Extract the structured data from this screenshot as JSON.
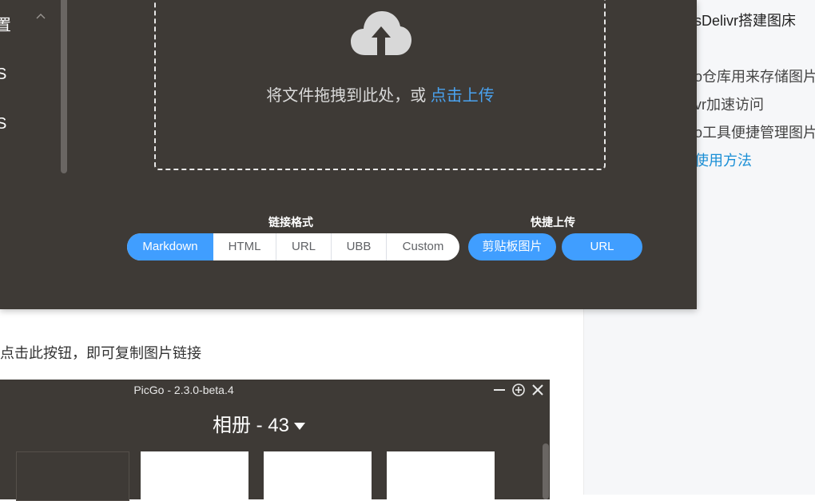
{
  "panel": {
    "side_items": [
      "置",
      "S",
      "S"
    ],
    "drop_text": "将文件拖拽到此处，或 ",
    "drop_link": "点击上传",
    "link_format_label": "链接格式",
    "quick_upload_label": "快捷上传",
    "formats": [
      {
        "label": "Markdown",
        "active": true
      },
      {
        "label": "HTML",
        "active": false
      },
      {
        "label": "URL",
        "active": false
      },
      {
        "label": "UBB",
        "active": false
      },
      {
        "label": "Custom",
        "active": false
      }
    ],
    "clipboard_button": "剪贴板图片",
    "url_button": "URL"
  },
  "toc": {
    "items": [
      {
        "text": "sDelivr搭建图床",
        "kind": "title"
      },
      {
        "text": "o仓库用来存储图片",
        "kind": "normal"
      },
      {
        "text": "vr加速访问",
        "kind": "normal"
      },
      {
        "text": "o工具便捷管理图片",
        "kind": "normal"
      },
      {
        "text": "使用方法",
        "kind": "link"
      }
    ]
  },
  "article": {
    "caption": "点击此按钮，即可复制图片链接"
  },
  "album": {
    "window_title": "PicGo - 2.3.0-beta.4",
    "heading": "相册 - 43"
  },
  "colors": {
    "panel_bg": "#3e3a36",
    "accent": "#409eff",
    "link": "#4aa3f0"
  }
}
